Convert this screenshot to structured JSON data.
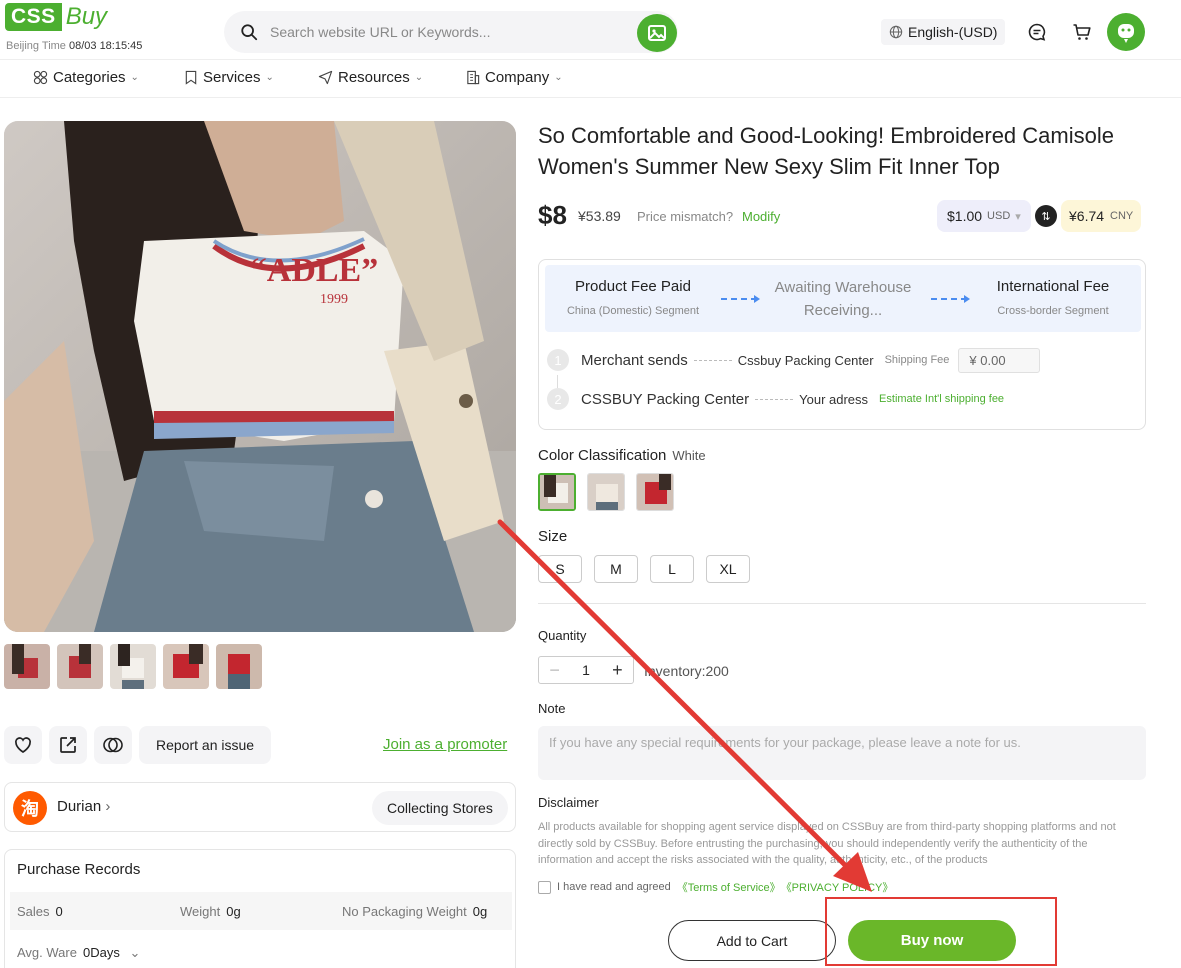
{
  "header": {
    "logo_box": "CSS",
    "logo_text": "Buy",
    "time_label": "Beijing Time",
    "time_value": "08/03 18:15:45",
    "search_placeholder": "Search website URL or Keywords...",
    "language": "English-(USD)"
  },
  "nav": {
    "items": [
      {
        "label": "Categories",
        "icon": "grid-icon"
      },
      {
        "label": "Services",
        "icon": "bookmark-icon"
      },
      {
        "label": "Resources",
        "icon": "send-icon"
      },
      {
        "label": "Company",
        "icon": "building-icon"
      }
    ]
  },
  "product": {
    "title": "So Comfortable and Good-Looking! Embroidered Camisole Women's Summer New Sexy Slim Fit Inner Top",
    "price_usd": "$8",
    "price_cny": "¥53.89",
    "mismatch_label": "Price mismatch?",
    "modify_label": "Modify",
    "rate_usd": "$1.00",
    "rate_usd_unit": "USD",
    "rate_cny": "¥6.74",
    "rate_cny_unit": "CNY"
  },
  "shipping": {
    "steps": [
      {
        "title": "Product Fee Paid",
        "sub": "China (Domestic) Segment"
      },
      {
        "title": "Awaiting Warehouse Receiving...",
        "sub": ""
      },
      {
        "title": "International Fee",
        "sub": "Cross-border Segment"
      }
    ],
    "route1": {
      "num": "1",
      "from": "Merchant sends",
      "to": "Cssbuy Packing Center",
      "fee_label": "Shipping Fee",
      "fee_value": "¥ 0.00"
    },
    "route2": {
      "num": "2",
      "from": "CSSBUY Packing Center",
      "to": "Your adress",
      "link": "Estimate Int'l shipping fee"
    }
  },
  "options": {
    "color_label": "Color Classification",
    "color_value": "White",
    "size_label": "Size",
    "sizes": [
      "S",
      "M",
      "L",
      "XL"
    ],
    "quantity_label": "Quantity",
    "quantity_value": "1",
    "inventory": "Inventory:200",
    "note_label": "Note",
    "note_placeholder": "If you have any special requirements for your package, please leave a note for us.",
    "disclaimer_label": "Disclaimer",
    "disclaimer_text": "All products available for shopping agent service displayed on CSSBuy are from third-party shopping platforms and not directly sold by CSSBuy. Before entrusting the purchasing, you should independently verify the authenticity of the information and accept the risks associated with the quality, authenticity, etc., of the products",
    "agree_text": "I have read and agreed",
    "terms": "《Terms of Service》",
    "privacy": "《PRIVACY POLICY》"
  },
  "actions": {
    "add_cart": "Add to Cart",
    "buy_now": "Buy now",
    "report": "Report an issue",
    "promoter": "Join as a promoter"
  },
  "store": {
    "logo_char": "淘",
    "name": "Durian",
    "collect": "Collecting Stores"
  },
  "records": {
    "title": "Purchase Records",
    "sales_label": "Sales",
    "sales_value": "0",
    "weight_label": "Weight",
    "weight_value": "0g",
    "nopack_label": "No Packaging Weight",
    "nopack_value": "0g",
    "avg_label": "Avg. Ware",
    "avg_value": "0Days"
  },
  "colors": {
    "accent": "#4caf30",
    "annotation": "#e23a34",
    "buy_button": "#6ab729"
  }
}
